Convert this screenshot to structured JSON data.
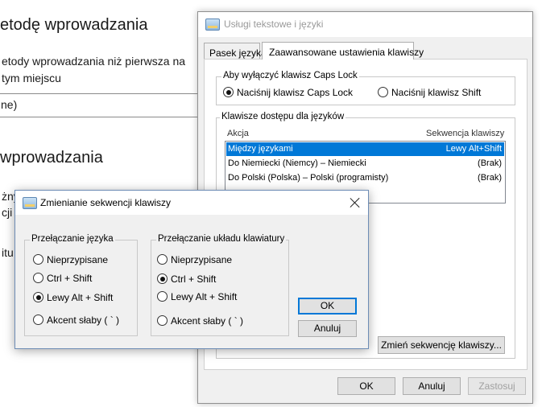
{
  "background_page": {
    "heading_fragment": "etodę wprowadzania",
    "text_line1": "etody wprowadzania niż pierwsza na",
    "text_line2": "tym miejscu",
    "select_value": "ne)",
    "heading2_fragment": "wprowadzania",
    "frag_a": "żny",
    "frag_b": "cji",
    "frag_c": "itu,"
  },
  "text_services_window": {
    "title": "Usługi tekstowe i języki",
    "tabs": [
      {
        "label": "Pasek języka",
        "active": false
      },
      {
        "label": "Zaawansowane ustawienia klawiszy",
        "active": true
      }
    ],
    "capslock_group": {
      "title": "Aby wyłączyć klawisz Caps Lock",
      "options": [
        {
          "label": "Naciśnij klawisz Caps Lock",
          "selected": true
        },
        {
          "label": "Naciśnij klawisz Shift",
          "selected": false
        }
      ]
    },
    "hotkeys_group": {
      "title": "Klawisze dostępu dla języków",
      "col_action": "Akcja",
      "col_sequence": "Sekwencja klawiszy",
      "rows": [
        {
          "action": "Między językami",
          "sequence": "Lewy Alt+Shift",
          "selected": true
        },
        {
          "action": "Do Niemiecki (Niemcy) – Niemiecki",
          "sequence": "(Brak)",
          "selected": false
        },
        {
          "action": "Do Polski (Polska) – Polski (programisty)",
          "sequence": "(Brak)",
          "selected": false
        }
      ],
      "change_button": "Zmień sekwencję klawiszy..."
    },
    "buttons": {
      "ok": "OK",
      "cancel": "Anuluj",
      "apply": "Zastosuj"
    }
  },
  "change_sequence_dialog": {
    "title": "Zmienianie sekwencji klawiszy",
    "input_language_group": {
      "title": "Przełączanie języka",
      "options": [
        {
          "label": "Nieprzypisane",
          "selected": false
        },
        {
          "label": "Ctrl + Shift",
          "selected": false
        },
        {
          "label": "Lewy Alt + Shift",
          "selected": true
        },
        {
          "label": "Akcent słaby ( ` )",
          "selected": false
        }
      ]
    },
    "keyboard_layout_group": {
      "title": "Przełączanie układu klawiatury",
      "options": [
        {
          "label": "Nieprzypisane",
          "selected": false
        },
        {
          "label": "Ctrl + Shift",
          "selected": true
        },
        {
          "label": "Lewy Alt + Shift",
          "selected": false
        },
        {
          "label": "Akcent słaby ( ` )",
          "selected": false
        }
      ]
    },
    "buttons": {
      "ok": "OK",
      "cancel": "Anuluj"
    }
  }
}
